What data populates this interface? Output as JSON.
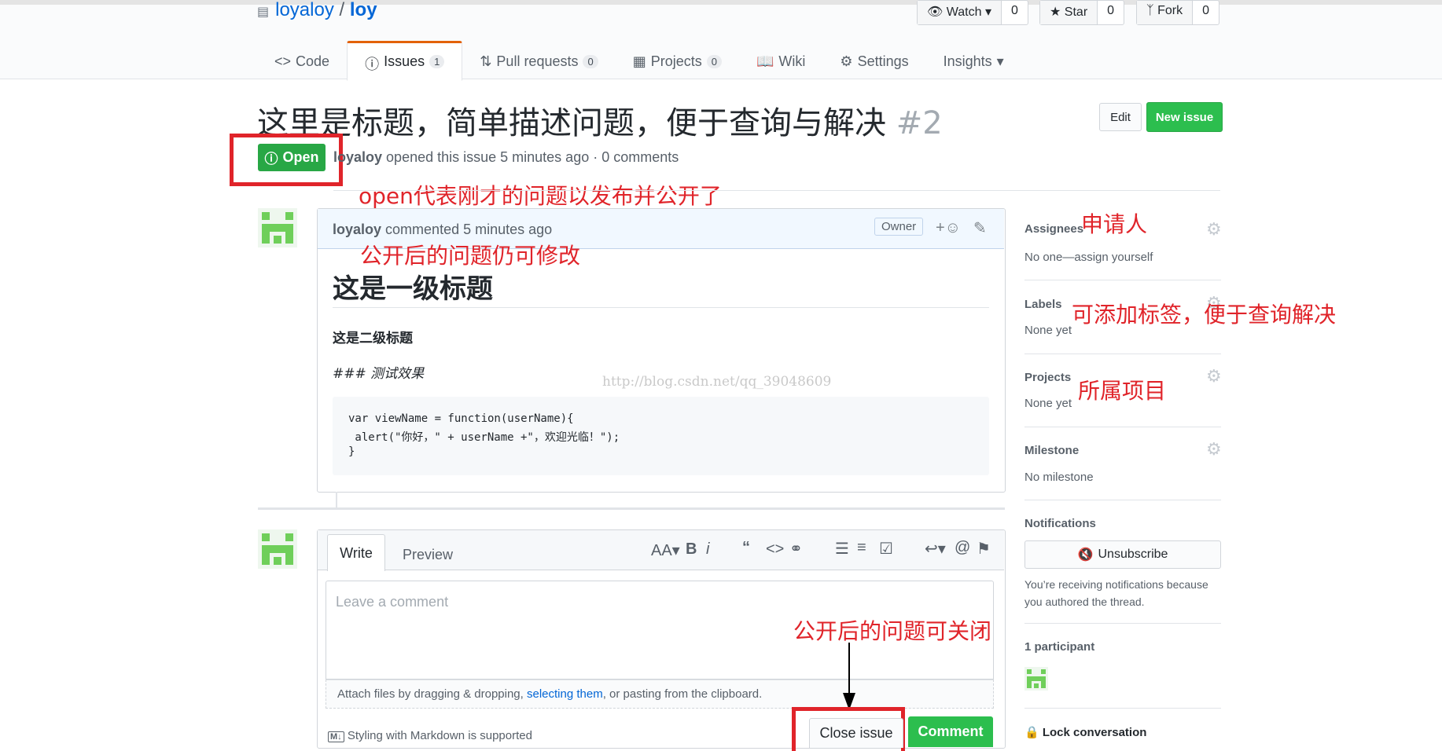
{
  "repo": {
    "owner": "loyaloy",
    "sep": "/",
    "name": "loy"
  },
  "actions": {
    "watch_label": "Watch",
    "watch_count": "0",
    "star_label": "Star",
    "star_count": "0",
    "fork_label": "Fork",
    "fork_count": "0"
  },
  "tabs": [
    {
      "label": "Code"
    },
    {
      "label": "Issues",
      "count": "1"
    },
    {
      "label": "Pull requests",
      "count": "0"
    },
    {
      "label": "Projects",
      "count": "0"
    },
    {
      "label": "Wiki"
    },
    {
      "label": "Settings"
    },
    {
      "label": "Insights"
    }
  ],
  "issue": {
    "title": "这里是标题，简单描述问题，便于查询与解决",
    "number": "#2",
    "state": "Open",
    "author": "loyaloy",
    "meta_text": "opened this issue 5 minutes ago · 0 comments",
    "edit_label": "Edit",
    "new_issue_label": "New issue"
  },
  "comment": {
    "author": "loyaloy",
    "time": "commented 5 minutes ago",
    "badge": "Owner",
    "h1": "这是一级标题",
    "h2": "这是二级标题",
    "h3_text": "### 测试效果",
    "code_lines": [
      "var viewName = function(userName){",
      " alert(\"你好，\" + userName +\"，欢迎光临！\");",
      "}"
    ],
    "watermark": "http://blog.csdn.net/qq_39048609"
  },
  "sidebar": {
    "assignees_label": "Assignees",
    "assignees_value": "No one—assign yourself",
    "labels_label": "Labels",
    "labels_value": "None yet",
    "projects_label": "Projects",
    "projects_value": "None yet",
    "milestone_label": "Milestone",
    "milestone_value": "No milestone",
    "notifications_label": "Notifications",
    "unsubscribe_label": "Unsubscribe",
    "notif_text_1": "You’re receiving notifications because",
    "notif_text_2": "you authored the thread.",
    "participants_label": "1 participant",
    "lock_label": "Lock conversation"
  },
  "editor": {
    "write_tab": "Write",
    "preview_tab": "Preview",
    "placeholder": "Leave a comment",
    "attach_before": "Attach files by dragging & dropping, ",
    "attach_link": "selecting them",
    "attach_after": ", or pasting from the clipboard.",
    "markdown_note": "Styling with Markdown is supported",
    "close_label": "Close issue",
    "comment_label": "Comment"
  },
  "annotations": {
    "open": "open代表刚才的问题以发布并公开了",
    "modify": "公开后的问题仍可修改",
    "assignees": "申请人",
    "labels": "可添加标签，便于查询解决",
    "projects": "所属项目",
    "close": "公开后的问题可关闭"
  },
  "colors": {
    "accent_green": "#2cbe4e",
    "annotation_red": "#e0242a",
    "link_blue": "#0366d6",
    "tab_orange": "#e36209"
  }
}
